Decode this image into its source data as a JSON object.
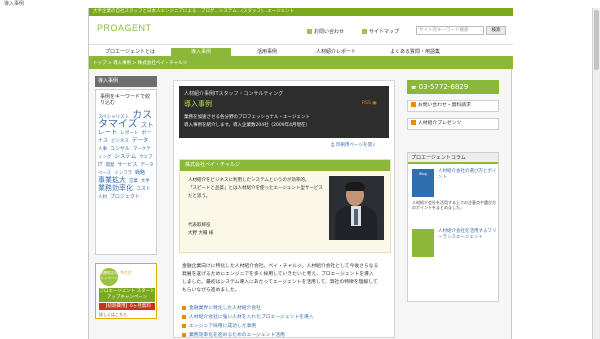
{
  "page": {
    "top_caption": "導入事例"
  },
  "header": {
    "tagline": "大手企業の自社スタッフと日本人エンジニアによる…ブログ…システム…(スタッフ)…エージェント",
    "logo": "PROAGENT",
    "link_contact": "お問い合わせ",
    "link_sitemap": "サイトマップ",
    "search_placeholder": "サイト内キーワード検索",
    "search_button": "検索"
  },
  "nav": [
    "プロエージェントとは",
    "導入事例",
    "活用事例",
    "人材紹介レポート",
    "よくある質問・用語集"
  ],
  "breadcrumb": "トップ > 導入事例 > 株式会社ペイ・チャルジ",
  "sidebar": {
    "title": "導入事例",
    "subtitle": "事例をキーワードで絞り込む",
    "cloud": [
      "スペシャリスト",
      "カスタマイズ",
      "ストレート",
      "レポート",
      "ボーナス",
      "ビジネス",
      "データ",
      "人事",
      "コンサル",
      "マーケティング",
      "システム",
      "ウェブ",
      "IT",
      "開発",
      "サービス",
      "データベース",
      "インフラ",
      "戦略",
      "事業拡大",
      "営業",
      "大手",
      "業務効率化",
      "コスト",
      "人材",
      "プロジェクト"
    ],
    "banner_badge": "期間限定キャンペーン",
    "banner_top": "今だけ",
    "banner_main": "プロエージェント スタートアップキャンペーン",
    "banner_price": "【初期費用】6ヶ月無料",
    "banner_more": "詳しくはこちら"
  },
  "article": {
    "category": "人材紹介事例ITスタッフ・コンサルティング",
    "title": "導入事例",
    "rss": "RSS",
    "summary_line1": "業務を加速させる各分野のプロフェッショナル・エージェント",
    "summary_line2": "導入事例を紹介します。導入企業数204社（2009年4月現在）",
    "print_link": "印刷用ページを開く",
    "case_head": "株式会社ペイ・チャルジ",
    "case_text": [
      "人材紹介をビジネスに利用したシステムというのが効率的。",
      "「スピードと品質」とは人材紹介を使ったエージェント型サービス",
      "だと思う。"
    ],
    "company_label": "代表取締役",
    "person_name": "大野 大輔 様",
    "body": [
      "金融企業向けに特化した人材紹介会社。ペイ・チャルジ。人材紹介会社として今後さらなる",
      "発展を遂げるためにエンジニアを多く採用していきたいと考え、プロエージェントを導入",
      "しました。最初はシステム導入にあたってエージェントを活用して、弊社の特徴を理解して",
      "もらいながら進めました。"
    ],
    "links": [
      "金融業界に特化した人材紹介会社",
      "人材紹介会社に強い人材を入れたプロエージェントを導入",
      "エンジニア採用に成功した事例",
      "業務効率化を進めるためのエージェント活用"
    ]
  },
  "rightcol": {
    "tel": "03-5772-6829",
    "btn_contact": "お問い合わせ・資料請求",
    "btn_voice": "人材紹介プレゼンツ",
    "column_title": "プロエージェントコラム",
    "col1_thumb": "Blog",
    "col1_title": "人材紹介会社の選び方とポイント",
    "col1_desc": "人材紹介会社を活用する上での注意点や選び方のポイントをまとめました。",
    "col2_title": "人材紹介会社を活用するフリーランスエージェント",
    "col2_desc": ""
  },
  "colors": {
    "accent": "#8cb83a",
    "dark": "#2d2d2d",
    "link": "#3a6fb0",
    "orange": "#f08a00"
  }
}
